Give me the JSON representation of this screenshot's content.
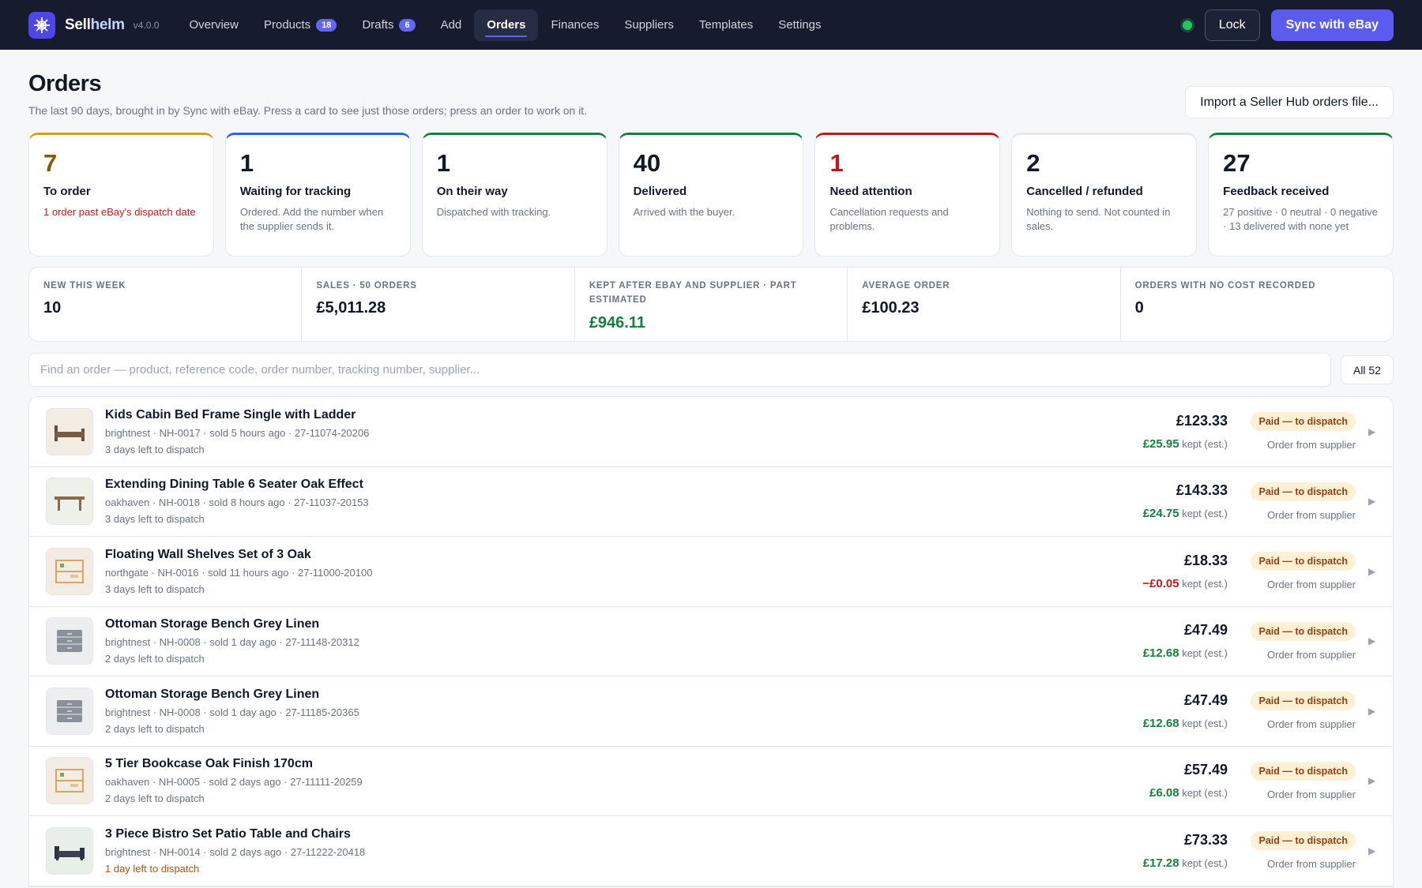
{
  "app": {
    "name_part1": "Sell",
    "name_part2": "helm",
    "version": "v4.0.0"
  },
  "nav": [
    {
      "label": "Overview"
    },
    {
      "label": "Products",
      "badge": "18"
    },
    {
      "label": "Drafts",
      "badge": "6"
    },
    {
      "label": "Add"
    },
    {
      "label": "Orders",
      "active": true
    },
    {
      "label": "Finances"
    },
    {
      "label": "Suppliers"
    },
    {
      "label": "Templates"
    },
    {
      "label": "Settings"
    }
  ],
  "top_actions": {
    "lock": "Lock",
    "sync": "Sync with eBay"
  },
  "page": {
    "title": "Orders",
    "subtitle": "The last 90 days, brought in by Sync with eBay. Press a card to see just those orders; press an order to work on it.",
    "import": "Import a Seller Hub orders file..."
  },
  "cards": [
    {
      "num": "7",
      "label": "To order",
      "desc": "1 order past eBay's dispatch date",
      "accent": "#d4a017",
      "num_color": "#8a5a00",
      "desc_color": "#b91c1c"
    },
    {
      "num": "1",
      "label": "Waiting for tracking",
      "desc": "Ordered. Add the number when the supplier sends it.",
      "accent": "#2563eb",
      "num_color": "#111827",
      "desc_color": "#6b7280"
    },
    {
      "num": "1",
      "label": "On their way",
      "desc": "Dispatched with tracking.",
      "accent": "#15803d",
      "num_color": "#111827",
      "desc_color": "#6b7280"
    },
    {
      "num": "40",
      "label": "Delivered",
      "desc": "Arrived with the buyer.",
      "accent": "#15803d",
      "num_color": "#111827",
      "desc_color": "#6b7280"
    },
    {
      "num": "1",
      "label": "Need attention",
      "desc": "Cancellation requests and problems.",
      "accent": "#b91c1c",
      "num_color": "#b91c1c",
      "desc_color": "#6b7280"
    },
    {
      "num": "2",
      "label": "Cancelled / refunded",
      "desc": "Nothing to send. Not counted in sales.",
      "accent": "#e5e7eb",
      "num_color": "#111827",
      "desc_color": "#6b7280"
    },
    {
      "num": "27",
      "label": "Feedback received",
      "desc": "27 positive · 0 neutral · 0 negative · 13 delivered with none yet",
      "accent": "#15803d",
      "num_color": "#111827",
      "desc_color": "#6b7280"
    }
  ],
  "summary": [
    {
      "label": "NEW THIS WEEK",
      "value": "10",
      "color": "#111827"
    },
    {
      "label": "SALES · 50 ORDERS",
      "value": "£5,011.28",
      "color": "#111827"
    },
    {
      "label": "KEPT AFTER EBAY AND SUPPLIER · PART ESTIMATED",
      "value": "£946.11",
      "color": "#15803d"
    },
    {
      "label": "AVERAGE ORDER",
      "value": "£100.23",
      "color": "#111827"
    },
    {
      "label": "ORDERS WITH NO COST RECORDED",
      "value": "0",
      "color": "#111827"
    }
  ],
  "search": {
    "placeholder": "Find an order — product, reference code, order number, tracking number, supplier...",
    "filter": "All 52"
  },
  "orders": [
    {
      "title": "Kids Cabin Bed Frame Single with Ladder",
      "meta": "brightnest · NH-0017 · sold 5 hours ago · 27-11074-20206",
      "due": "3 days left to dispatch",
      "urgent": false,
      "price": "£123.33",
      "kept": "£25.95",
      "neg": false,
      "status": "Paid — to dispatch",
      "next": "Order from supplier",
      "icon": "bed-icon",
      "thumb_bg": "#f3ece2"
    },
    {
      "title": "Extending Dining Table 6 Seater Oak Effect",
      "meta": "oakhaven · NH-0018 · sold 8 hours ago · 27-11037-20153",
      "due": "3 days left to dispatch",
      "urgent": false,
      "price": "£143.33",
      "kept": "£24.75",
      "neg": false,
      "status": "Paid — to dispatch",
      "next": "Order from supplier",
      "icon": "table-icon",
      "thumb_bg": "#eef1ea"
    },
    {
      "title": "Floating Wall Shelves Set of 3 Oak",
      "meta": "northgate · NH-0016 · sold 11 hours ago · 27-11000-20100",
      "due": "3 days left to dispatch",
      "urgent": false,
      "price": "£18.33",
      "kept": "−£0.05",
      "neg": true,
      "status": "Paid — to dispatch",
      "next": "Order from supplier",
      "icon": "shelves-icon",
      "thumb_bg": "#f3ece2"
    },
    {
      "title": "Ottoman Storage Bench Grey Linen",
      "meta": "brightnest · NH-0008 · sold 1 day ago · 27-11148-20312",
      "due": "2 days left to dispatch",
      "urgent": false,
      "price": "£47.49",
      "kept": "£12.68",
      "neg": false,
      "status": "Paid — to dispatch",
      "next": "Order from supplier",
      "icon": "drawers-icon",
      "thumb_bg": "#eceef0"
    },
    {
      "title": "Ottoman Storage Bench Grey Linen",
      "meta": "brightnest · NH-0008 · sold 1 day ago · 27-11185-20365",
      "due": "2 days left to dispatch",
      "urgent": false,
      "price": "£47.49",
      "kept": "£12.68",
      "neg": false,
      "status": "Paid — to dispatch",
      "next": "Order from supplier",
      "icon": "drawers-icon",
      "thumb_bg": "#eceef0"
    },
    {
      "title": "5 Tier Bookcase Oak Finish 170cm",
      "meta": "oakhaven · NH-0005 · sold 2 days ago · 27-11111-20259",
      "due": "2 days left to dispatch",
      "urgent": false,
      "price": "£57.49",
      "kept": "£6.08",
      "neg": false,
      "status": "Paid — to dispatch",
      "next": "Order from supplier",
      "icon": "shelves-icon",
      "thumb_bg": "#f3ece2"
    },
    {
      "title": "3 Piece Bistro Set Patio Table and Chairs",
      "meta": "brightnest · NH-0014 · sold 2 days ago · 27-11222-20418",
      "due": "1 day left to dispatch",
      "urgent": true,
      "price": "£73.33",
      "kept": "£17.28",
      "neg": false,
      "status": "Paid — to dispatch",
      "next": "Order from supplier",
      "icon": "sofa-icon",
      "thumb_bg": "#e8eee8"
    }
  ],
  "labels": {
    "kept_suffix": "kept (est.)"
  }
}
